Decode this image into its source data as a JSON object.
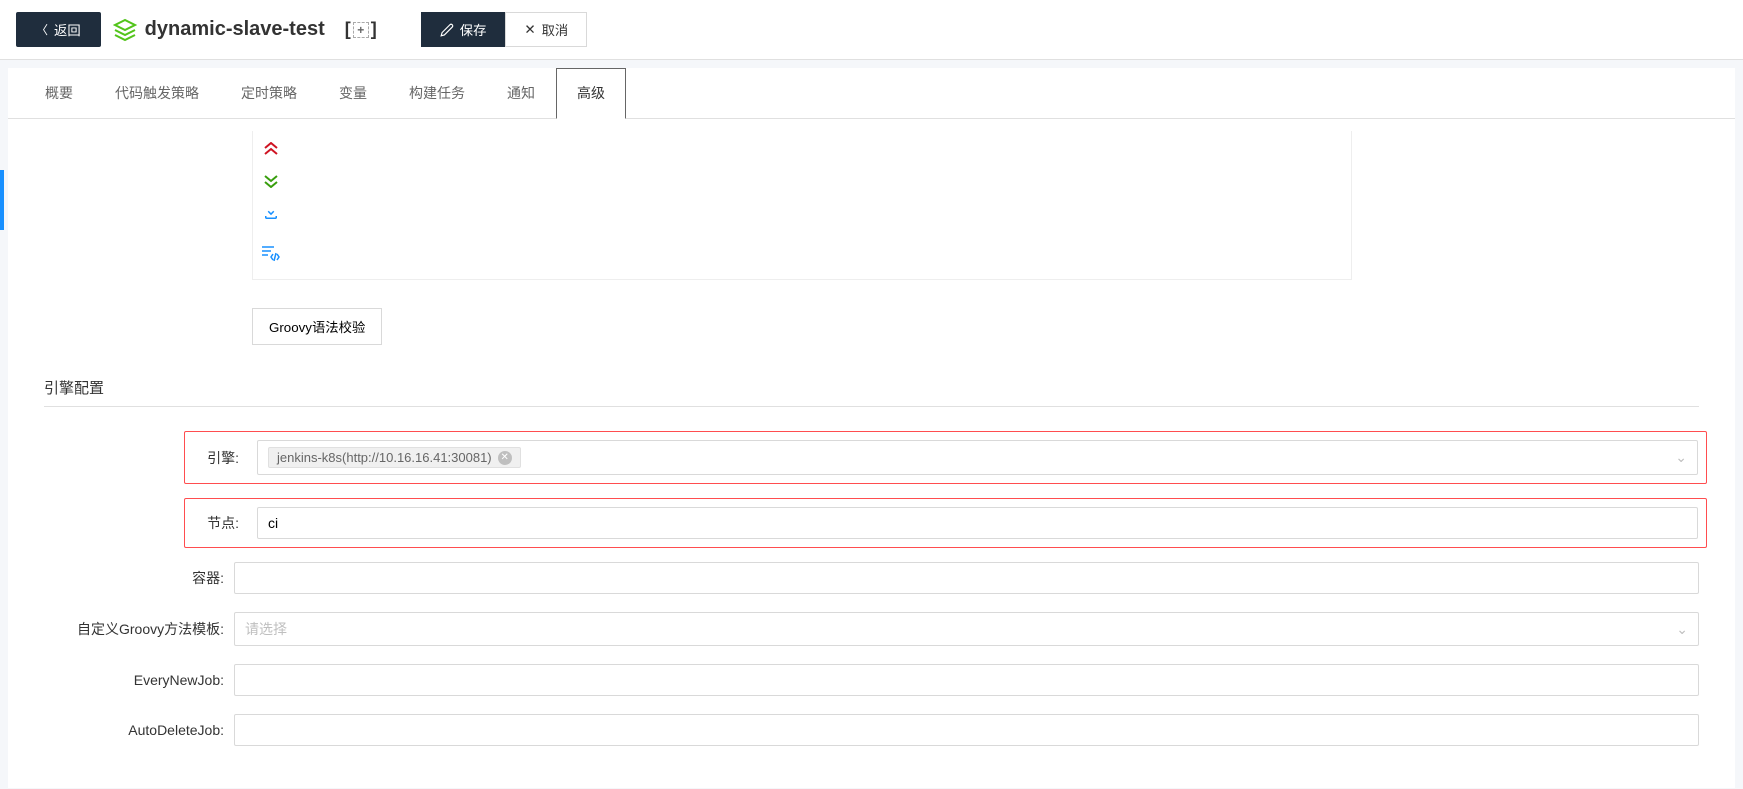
{
  "header": {
    "back_label": "返回",
    "title": "dynamic-slave-test",
    "save_label": "保存",
    "cancel_label": "取消"
  },
  "tabs": [
    {
      "id": "overview",
      "label": "概要"
    },
    {
      "id": "trigger",
      "label": "代码触发策略"
    },
    {
      "id": "schedule",
      "label": "定时策略"
    },
    {
      "id": "variables",
      "label": "变量"
    },
    {
      "id": "build",
      "label": "构建任务"
    },
    {
      "id": "notify",
      "label": "通知"
    },
    {
      "id": "advanced",
      "label": "高级"
    }
  ],
  "active_tab": "advanced",
  "groovy": {
    "validate_label": "Groovy语法校验"
  },
  "engine_section": {
    "title": "引擎配置",
    "fields": {
      "engine": {
        "label": "引擎:",
        "tag": "jenkins-k8s(http://10.16.16.41:30081)"
      },
      "node": {
        "label": "节点:",
        "value": "ci"
      },
      "container": {
        "label": "容器:",
        "value": ""
      },
      "groovy_template": {
        "label": "自定义Groovy方法模板:",
        "placeholder": "请选择"
      },
      "every_new_job": {
        "label": "EveryNewJob:",
        "value": ""
      },
      "auto_delete_job": {
        "label": "AutoDeleteJob:",
        "value": ""
      }
    }
  }
}
